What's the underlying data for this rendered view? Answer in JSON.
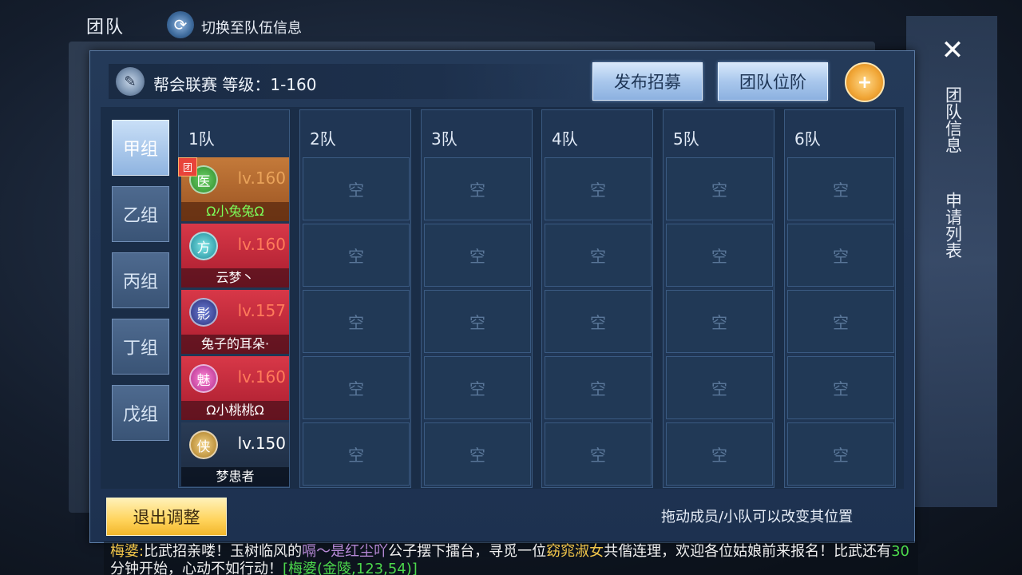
{
  "header": {
    "title": "团队",
    "switch_label": "切换至队伍信息"
  },
  "league": {
    "title": "帮会联赛  等级：1-160"
  },
  "buttons": {
    "recruit": "发布招募",
    "rank": "团队位阶",
    "exit": "退出调整"
  },
  "groups": [
    {
      "label": "甲组",
      "active": true
    },
    {
      "label": "乙组",
      "active": false
    },
    {
      "label": "丙组",
      "active": false
    },
    {
      "label": "丁组",
      "active": false
    },
    {
      "label": "戊组",
      "active": false
    }
  ],
  "teams": [
    {
      "name": "1队",
      "members": [
        {
          "class_icon": "医",
          "level": "lv.160",
          "name": "Ω小兔兔Ω",
          "leader": true,
          "leader_mark": "团",
          "style": "orange"
        },
        {
          "class_icon": "方",
          "level": "lv.160",
          "name": "云梦丶",
          "leader": false,
          "style": "red"
        },
        {
          "class_icon": "影",
          "level": "lv.157",
          "name": "兔子的耳朵·",
          "leader": false,
          "style": "red"
        },
        {
          "class_icon": "魅",
          "level": "lv.160",
          "name": "Ω小桃桃Ω",
          "leader": false,
          "style": "red"
        },
        {
          "class_icon": "侠",
          "level": "lv.150",
          "name": "梦患者",
          "leader": false,
          "style": "dark"
        }
      ]
    },
    {
      "name": "2队",
      "members": []
    },
    {
      "name": "3队",
      "members": []
    },
    {
      "name": "4队",
      "members": []
    },
    {
      "name": "5队",
      "members": []
    },
    {
      "name": "6队",
      "members": []
    }
  ],
  "empty_label": "空",
  "hint": "拖动成员/小队可以改变其位置",
  "side_tabs": {
    "team_info": "团队信息",
    "apply_list": "申请列表"
  },
  "chat": {
    "speaker": "梅婆:",
    "seg1": "比武招亲喽！玉树临风的",
    "player": "嗝～是红尘吖",
    "seg2": "公子摆下擂台，寻觅一位",
    "highlight": "窈窕淑女",
    "seg3": "共偕连理，欢迎各位姑娘前来报名！比武还有",
    "minutes": "30",
    "seg4": "分钟开始，心动不如行动！",
    "location": "[梅婆(金陵,123,54)]"
  },
  "colors": {
    "accent_gold": "#f2c64a",
    "member_red": "#c0283a",
    "member_orange": "#b5672c",
    "green_text": "#4cd84c"
  }
}
